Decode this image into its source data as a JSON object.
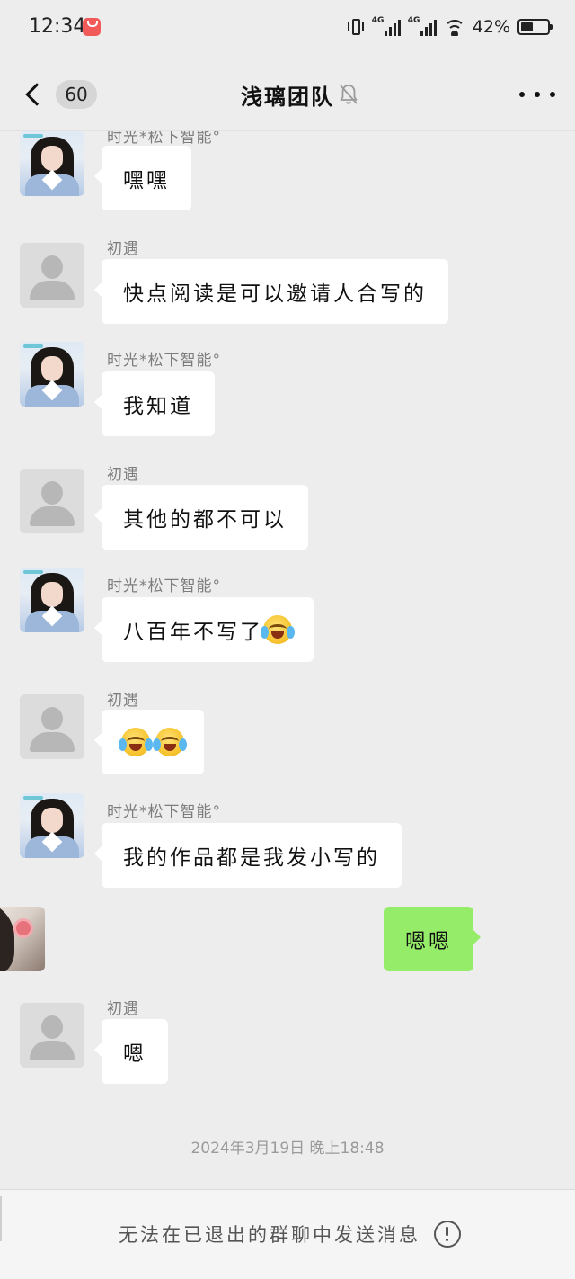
{
  "status_bar": {
    "time": "12:34",
    "network_label_1": "4G",
    "network_label_2": "4G",
    "battery": "42%"
  },
  "nav": {
    "unread_count": "60",
    "title": "浅璃团队"
  },
  "messages": [
    {
      "sender": "时光*松下智能°",
      "text": "嘿嘿",
      "side": "left",
      "avatar": "girl-avatar"
    },
    {
      "sender": "初遇",
      "text": "快点阅读是可以邀请人合写的",
      "side": "left",
      "avatar": "default-avatar"
    },
    {
      "sender": "时光*松下智能°",
      "text": "我知道",
      "side": "left",
      "avatar": "girl-avatar"
    },
    {
      "sender": "初遇",
      "text": "其他的都不可以",
      "side": "left",
      "avatar": "default-avatar"
    },
    {
      "sender": "时光*松下智能°",
      "text": "八百年不写了",
      "emoji": "laugh-cry-emoji",
      "side": "left",
      "avatar": "girl-avatar"
    },
    {
      "sender": "初遇",
      "text": "",
      "emoji_count": 2,
      "emoji": "laugh-cry-emoji",
      "side": "left",
      "avatar": "default-avatar"
    },
    {
      "sender": "时光*松下智能°",
      "text": "我的作品都是我发小写的",
      "side": "left",
      "avatar": "girl-avatar"
    },
    {
      "sender": "",
      "text": "嗯嗯",
      "side": "right",
      "avatar": "self-avatar"
    },
    {
      "sender": "初遇",
      "text": "嗯",
      "side": "left",
      "avatar": "default-avatar"
    }
  ],
  "timestamp": "2024年3月19日 晚上18:48",
  "footer": {
    "notice": "无法在已退出的群聊中发送消息"
  },
  "colors": {
    "background": "#ededed",
    "self_bubble": "#95ec69",
    "other_bubble": "#ffffff"
  }
}
